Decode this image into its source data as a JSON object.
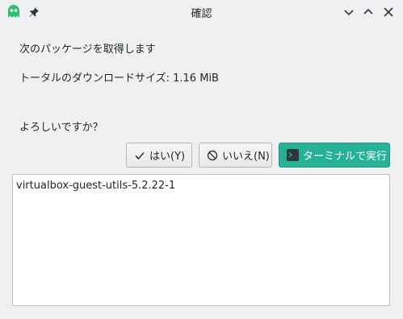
{
  "window": {
    "title": "確認",
    "icons": {
      "app": "ghost-icon",
      "pin": "pin-icon",
      "minimize": "chevron-down-icon",
      "maximize": "chevron-up-icon",
      "close": "close-icon"
    }
  },
  "message": {
    "line1": "次のパッケージを取得します",
    "line2": "トータルのダウンロードサイズ: 1.16 MiB",
    "question": "よろしいですか？"
  },
  "buttons": {
    "yes_label": "はい(Y)",
    "no_label": "いいえ(N)",
    "terminal_label": "ターミナルで実行"
  },
  "packages": [
    "virtualbox-guest-utils-5.2.22-1"
  ],
  "colors": {
    "accent": "#27b197",
    "app_icon": "#2fbf71",
    "background": "#eff0f1"
  }
}
